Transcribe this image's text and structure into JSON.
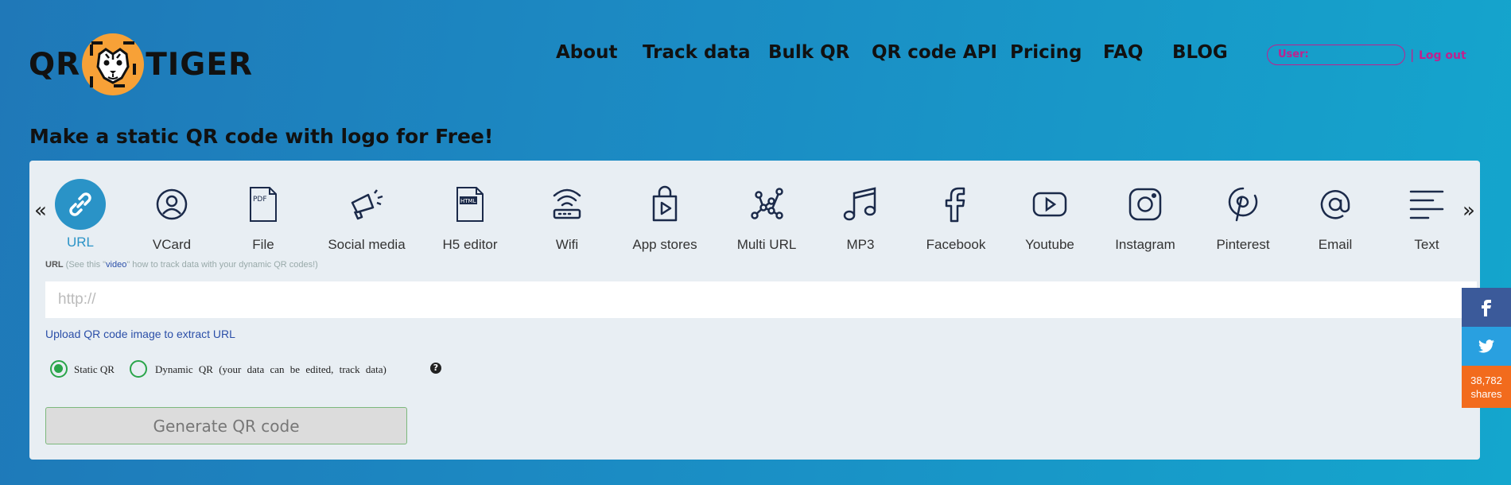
{
  "brand": {
    "left": "QR",
    "right": "TIGER"
  },
  "nav": {
    "items": [
      {
        "label": "About"
      },
      {
        "label": "Track data"
      },
      {
        "label": "Bulk QR"
      },
      {
        "label": "QR code API"
      },
      {
        "label": "Pricing"
      },
      {
        "label": "FAQ"
      },
      {
        "label": "BLOG"
      }
    ],
    "user_label": "User:",
    "separator": "|",
    "logout_label": "Log out"
  },
  "headline": "Make a static QR code with logo for Free!",
  "tabs": {
    "prev_arrow": "«",
    "next_arrow": "»",
    "items": [
      {
        "label": "URL",
        "icon": "link-icon",
        "active": true
      },
      {
        "label": "VCard",
        "icon": "user-circle-icon"
      },
      {
        "label": "File",
        "icon": "pdf-file-icon"
      },
      {
        "label": "Social media",
        "icon": "megaphone-icon"
      },
      {
        "label": "H5 editor",
        "icon": "html-file-icon"
      },
      {
        "label": "Wifi",
        "icon": "wifi-router-icon"
      },
      {
        "label": "App stores",
        "icon": "shopping-bag-play-icon"
      },
      {
        "label": "Multi URL",
        "icon": "network-nodes-icon"
      },
      {
        "label": "MP3",
        "icon": "music-note-icon"
      },
      {
        "label": "Facebook",
        "icon": "facebook-icon"
      },
      {
        "label": "Youtube",
        "icon": "youtube-icon"
      },
      {
        "label": "Instagram",
        "icon": "instagram-icon"
      },
      {
        "label": "Pinterest",
        "icon": "pinterest-icon"
      },
      {
        "label": "Email",
        "icon": "at-sign-icon"
      },
      {
        "label": "Text",
        "icon": "text-lines-icon"
      }
    ]
  },
  "form": {
    "url_label": "URL",
    "hint_prefix": "(See this \"",
    "hint_link": "video",
    "hint_suffix": "\" how to track data with your dynamic QR codes!)",
    "url_placeholder": "http://",
    "url_value": "",
    "upload_link": "Upload QR code image to extract URL",
    "static_label": "Static QR",
    "dynamic_label": "Dynamic QR (your data can be edited, track data)",
    "selected": "static",
    "help_icon": "?",
    "generate_label": "Generate QR code"
  },
  "share": {
    "count": "38,782",
    "count_label": "shares",
    "facebook_icon": "f",
    "twitter_icon": "twitter-bird-icon"
  },
  "colors": {
    "accent": "#2a93c7",
    "brand_orange": "#f7a137",
    "user_pink": "#c0208e",
    "radio_green": "#2aa54a",
    "facebook_blue": "#3b5a9a",
    "twitter_blue": "#29a0e0",
    "share_orange": "#f26b1d"
  }
}
